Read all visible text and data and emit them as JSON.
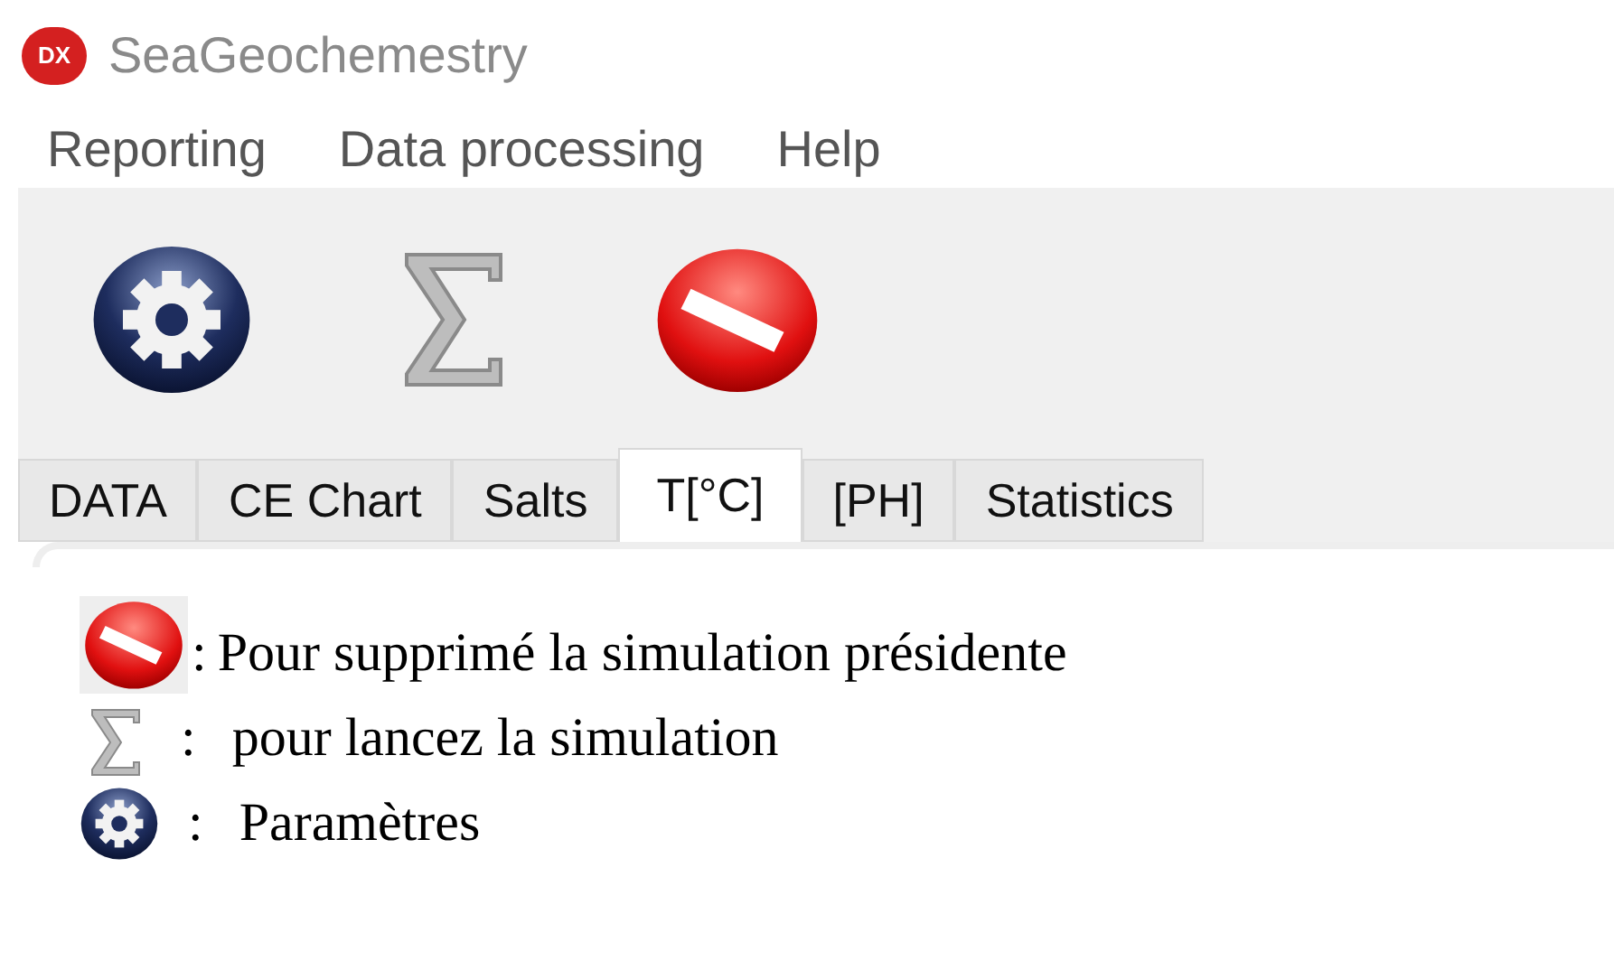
{
  "window": {
    "title": "SeaGeochemestry",
    "logo": "DX"
  },
  "menu": [
    "Reporting",
    "Data processing",
    "Help"
  ],
  "toolbar": [
    {
      "kind": "settings"
    },
    {
      "kind": "sum"
    },
    {
      "kind": "stop"
    }
  ],
  "tabs": [
    {
      "label": "DATA",
      "selected": false
    },
    {
      "label": "CE Chart",
      "selected": false
    },
    {
      "label": "Salts",
      "selected": false
    },
    {
      "label": "T[°C]",
      "selected": true
    },
    {
      "label": "[PH]",
      "selected": false
    },
    {
      "label": "Statistics",
      "selected": false
    }
  ],
  "legend": [
    {
      "kind": "stop",
      "colon": ":",
      "text": "Pour supprimé la simulation présidente"
    },
    {
      "kind": "sum",
      "colon": ":",
      "text": "pour lancez la simulation"
    },
    {
      "kind": "settings",
      "colon": ":",
      "text": "Paramètres"
    }
  ]
}
